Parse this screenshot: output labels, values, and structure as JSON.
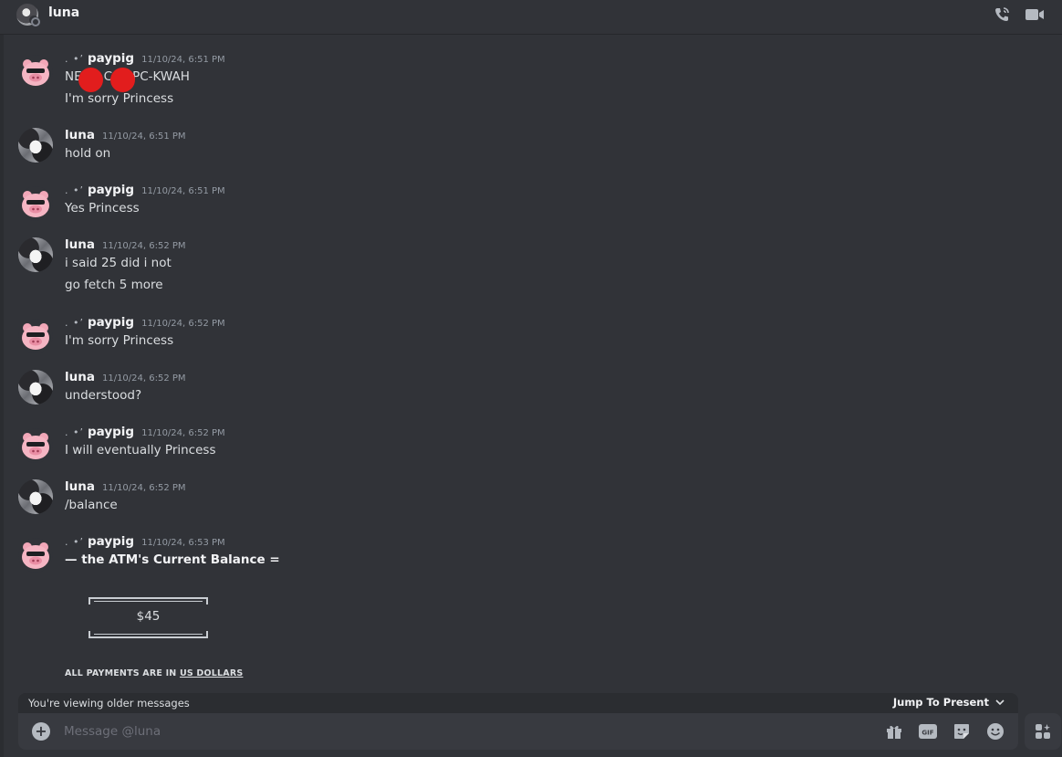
{
  "header": {
    "dm_name": "luna"
  },
  "messages": [
    {
      "username": "paypig",
      "deco": ". •’",
      "timestamp": "11/10/24, 6:51 PM",
      "lines": [
        "NE",
        "C",
        "PC-KWAH",
        "I'm sorry Princess"
      ]
    },
    {
      "username": "luna",
      "timestamp": "11/10/24, 6:51 PM",
      "lines": [
        "hold on"
      ]
    },
    {
      "username": "paypig",
      "deco": ". •’",
      "timestamp": "11/10/24, 6:51 PM",
      "lines": [
        "Yes Princess"
      ]
    },
    {
      "username": "luna",
      "timestamp": "11/10/24, 6:52 PM",
      "lines": [
        "i said 25 did i not",
        "go fetch 5 more"
      ]
    },
    {
      "username": "paypig",
      "deco": ". •’",
      "timestamp": "11/10/24, 6:52 PM",
      "lines": [
        "I'm sorry Princess"
      ]
    },
    {
      "username": "luna",
      "timestamp": "11/10/24, 6:52 PM",
      "lines": [
        "understood?"
      ]
    },
    {
      "username": "paypig",
      "deco": ". •’",
      "timestamp": "11/10/24, 6:52 PM",
      "lines": [
        "I will eventually Princess"
      ]
    },
    {
      "username": "luna",
      "timestamp": "11/10/24, 6:52 PM",
      "lines": [
        "/balance"
      ]
    },
    {
      "username": "paypig",
      "deco": ". •’",
      "timestamp": "11/10/24, 6:53 PM",
      "lines": [
        "— the ATM's Current Balance ="
      ]
    }
  ],
  "balance": {
    "value": "$45",
    "footer_prefix": "ALL PAYMENTS ARE IN",
    "footer_link": "US DOLLARS"
  },
  "older_bar": {
    "text": "You're viewing older messages",
    "jump_label": "Jump To Present"
  },
  "composer": {
    "placeholder": "Message @luna"
  },
  "icons": {
    "call": "phone-call-icon",
    "video": "video-camera-icon",
    "add": "plus-circle-icon",
    "gift": "gift-icon",
    "gif": "gif-icon",
    "sticker": "sticker-icon",
    "emoji": "emoji-icon",
    "apps": "apps-icon"
  },
  "colors": {
    "background": "#313338",
    "composer": "#383a40",
    "redaction": "#e21d1d",
    "pig_pink": "#f2a7b8"
  }
}
